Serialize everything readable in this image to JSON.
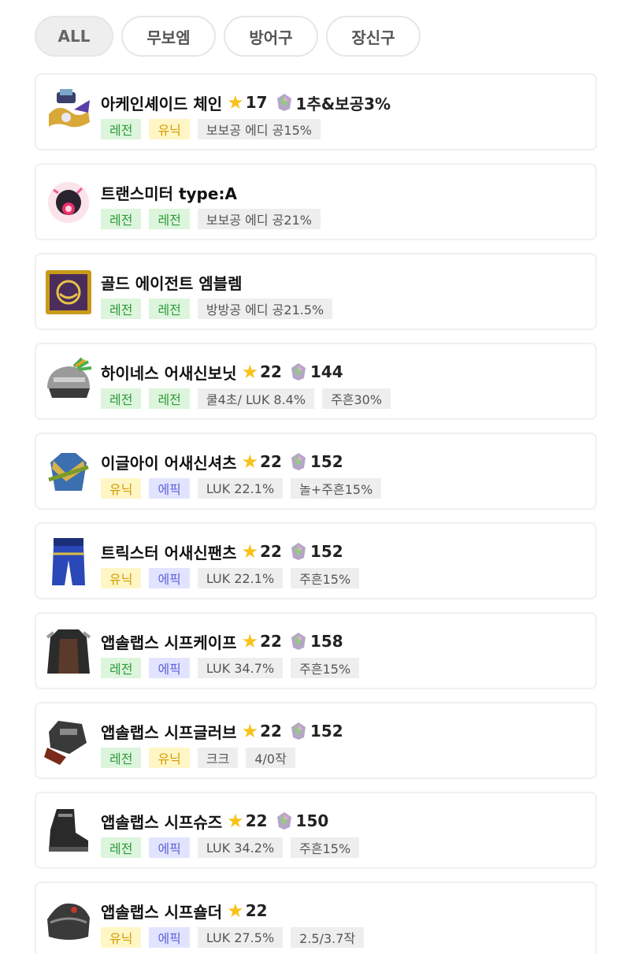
{
  "filters": {
    "all": "ALL",
    "weapon": "무보엠",
    "armor": "방어구",
    "accessory": "장신구"
  },
  "items": [
    {
      "name": "아케인셰이드 체인",
      "icon": "arcane-shade-chain-icon",
      "star": "17",
      "gem": "1추&보공3%",
      "tags": [
        {
          "label": "레전",
          "kind": "legend"
        },
        {
          "label": "유닉",
          "kind": "unique"
        },
        {
          "label": "보보공 에디 공15%",
          "kind": "opt"
        }
      ]
    },
    {
      "name": "트랜스미터 type:A",
      "icon": "transmitter-icon",
      "star": "",
      "gem": "",
      "tags": [
        {
          "label": "레전",
          "kind": "legend"
        },
        {
          "label": "레전",
          "kind": "legend"
        },
        {
          "label": "보보공 에디 공21%",
          "kind": "opt"
        }
      ]
    },
    {
      "name": "골드 에이전트 엠블렘",
      "icon": "gold-agent-emblem-icon",
      "star": "",
      "gem": "",
      "tags": [
        {
          "label": "레전",
          "kind": "legend"
        },
        {
          "label": "레전",
          "kind": "legend"
        },
        {
          "label": "방방공 에디 공21.5%",
          "kind": "opt"
        }
      ]
    },
    {
      "name": "하이네스 어새신보닛",
      "icon": "helmet-icon",
      "star": "22",
      "gem": "144",
      "tags": [
        {
          "label": "레전",
          "kind": "legend"
        },
        {
          "label": "레전",
          "kind": "legend"
        },
        {
          "label": "쿨4초/ LUK 8.4%",
          "kind": "opt"
        },
        {
          "label": "주흔30%",
          "kind": "opt"
        }
      ]
    },
    {
      "name": "이글아이 어새신셔츠",
      "icon": "shirt-icon",
      "star": "22",
      "gem": "152",
      "tags": [
        {
          "label": "유닉",
          "kind": "unique"
        },
        {
          "label": "에픽",
          "kind": "epic"
        },
        {
          "label": "LUK 22.1%",
          "kind": "opt"
        },
        {
          "label": "놀+주흔15%",
          "kind": "opt"
        }
      ]
    },
    {
      "name": "트릭스터 어새신팬츠",
      "icon": "pants-icon",
      "star": "22",
      "gem": "152",
      "tags": [
        {
          "label": "유닉",
          "kind": "unique"
        },
        {
          "label": "에픽",
          "kind": "epic"
        },
        {
          "label": "LUK 22.1%",
          "kind": "opt"
        },
        {
          "label": "주흔15%",
          "kind": "opt"
        }
      ]
    },
    {
      "name": "앱솔랩스 시프케이프",
      "icon": "cape-icon",
      "star": "22",
      "gem": "158",
      "tags": [
        {
          "label": "레전",
          "kind": "legend"
        },
        {
          "label": "에픽",
          "kind": "epic"
        },
        {
          "label": "LUK 34.7%",
          "kind": "opt"
        },
        {
          "label": "주흔15%",
          "kind": "opt"
        }
      ]
    },
    {
      "name": "앱솔랩스 시프글러브",
      "icon": "glove-icon",
      "star": "22",
      "gem": "152",
      "tags": [
        {
          "label": "레전",
          "kind": "legend"
        },
        {
          "label": "유닉",
          "kind": "unique"
        },
        {
          "label": "크크",
          "kind": "opt"
        },
        {
          "label": "4/0작",
          "kind": "opt"
        }
      ]
    },
    {
      "name": "앱솔랩스 시프슈즈",
      "icon": "shoes-icon",
      "star": "22",
      "gem": "150",
      "tags": [
        {
          "label": "레전",
          "kind": "legend"
        },
        {
          "label": "에픽",
          "kind": "epic"
        },
        {
          "label": "LUK 34.2%",
          "kind": "opt"
        },
        {
          "label": "주흔15%",
          "kind": "opt"
        }
      ]
    },
    {
      "name": "앱솔랩스 시프숄더",
      "icon": "shoulder-icon",
      "star": "22",
      "gem": "",
      "tags": [
        {
          "label": "유닉",
          "kind": "unique"
        },
        {
          "label": "에픽",
          "kind": "epic"
        },
        {
          "label": "LUK 27.5%",
          "kind": "opt"
        },
        {
          "label": "2.5/3.7작",
          "kind": "opt"
        }
      ]
    }
  ],
  "colors": {
    "legend_bg": "#dcf5dc",
    "legend_fg": "#2f9a3a",
    "unique_bg": "#fff6c6",
    "unique_fg": "#d39b00",
    "epic_bg": "#e2e4ff",
    "epic_fg": "#5f61d9",
    "star": "#f7c21a"
  }
}
